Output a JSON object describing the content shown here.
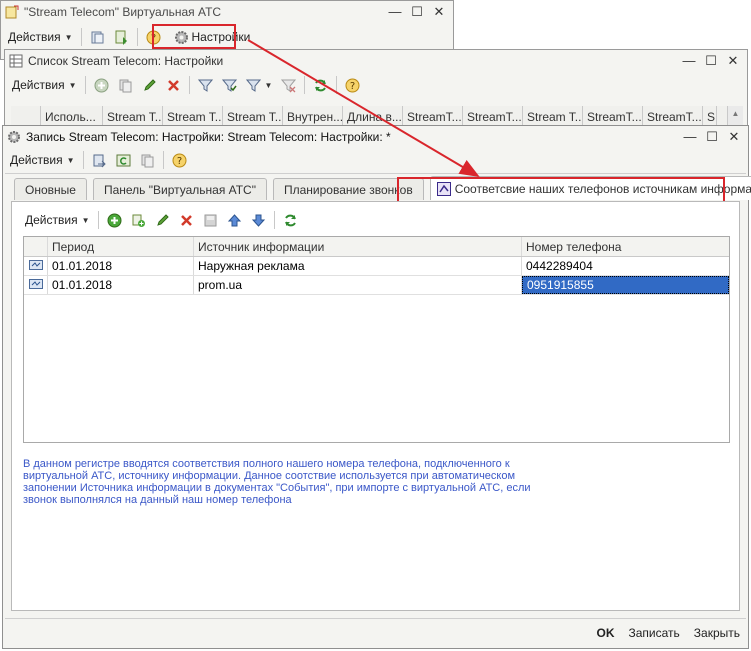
{
  "win1": {
    "title": "\"Stream Telecom\" Виртуальная АТС",
    "actions_label": "Действия",
    "settings_label": "Настройки"
  },
  "win2": {
    "title": "Список Stream Telecom: Настройки",
    "actions_label": "Действия",
    "columns": [
      "Исполь...",
      "Stream T...",
      "Stream T...",
      "Stream T...",
      "Внутрен...",
      "Длина в...",
      "StreamT...",
      "StreamT...",
      "Stream T...",
      "StreamT...",
      "StreamT...",
      "S"
    ]
  },
  "win3": {
    "title": "Запись Stream Telecom: Настройки: Stream Telecom: Настройки: *",
    "actions_label": "Действия",
    "tabs": [
      "Оновные",
      "Панель \"Виртуальная АТС\"",
      "Планирование звонков",
      "Соответсвие наших телефонов источникам информации"
    ],
    "inner_actions_label": "Действия",
    "table": {
      "columns": [
        "Период",
        "Источник информации",
        "Номер телефона"
      ],
      "rows": [
        {
          "period": "01.01.2018",
          "source": "Наружная реклама",
          "phone": "0442289404"
        },
        {
          "period": "01.01.2018",
          "source": "prom.ua",
          "phone": "0951915855"
        }
      ]
    },
    "info_lines": [
      "В данном регистре вводятся соответствия полного нашего номера телефона, подключенного к",
      "виртуальной АТС, источнику информации. Данное соотствие используется при автоматическом",
      "запонении Источника информации в документах \"События\", при импорте с виртуальной АТС, если",
      "звонок выполнялся на данный наш номер телефона"
    ],
    "ok_label": "OK",
    "save_label": "Записать",
    "close_label": "Закрыть"
  },
  "colors": {
    "highlight": "#d9262c",
    "arrow": "#d9262c",
    "selection": "#316ac5",
    "info_text": "#3b58c8"
  }
}
